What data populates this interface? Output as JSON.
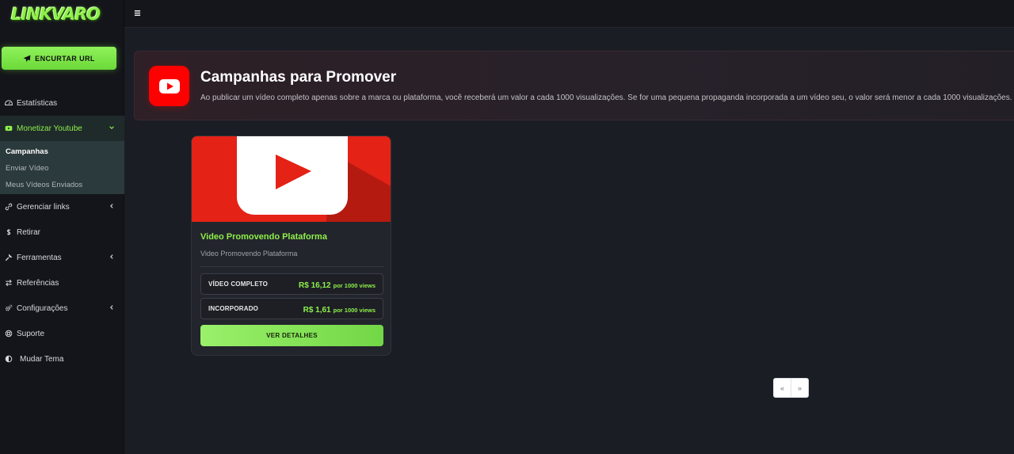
{
  "sidebar": {
    "logo_text": "LINKVARO",
    "shorten_button": "ENCURTAR URL",
    "items": [
      {
        "label": "Estatísticas",
        "icon": "dashboard-icon"
      },
      {
        "label": "Monetizar Youtube",
        "icon": "youtube-icon"
      },
      {
        "label": "Gerenciar links",
        "icon": "link-icon"
      },
      {
        "label": "Retirar",
        "icon": "dollar-icon"
      },
      {
        "label": "Ferramentas",
        "icon": "wrench-icon"
      },
      {
        "label": "Referências",
        "icon": "exchange-icon"
      },
      {
        "label": "Configurações",
        "icon": "cogs-icon"
      },
      {
        "label": "Suporte",
        "icon": "lifebuoy-icon"
      },
      {
        "label": "Mudar Tema",
        "icon": "contrast-icon"
      }
    ],
    "submenu": [
      {
        "label": "Campanhas"
      },
      {
        "label": "Enviar Vídeo"
      },
      {
        "label": "Meus Vídeos Enviados"
      }
    ]
  },
  "banner": {
    "title": "Campanhas para Promover",
    "description": "Ao publicar um vídeo completo apenas sobre a marca ou plataforma, você receberá um valor a cada 1000 visualizações. Se for uma pequena propaganda incorporada a um vídeo seu, o valor será menor a cada 1000 visualizações."
  },
  "card": {
    "title": "Video Promovendo Plataforma",
    "subtitle": "Video Promovendo Plataforma",
    "prices": [
      {
        "label": "VÍDEO COMPLETO",
        "value": "R$ 16,12",
        "unit": "por 1000 views"
      },
      {
        "label": "INCORPORADO",
        "value": "R$ 1,61",
        "unit": "por 1000 views"
      }
    ],
    "details_button": "VER DETALHES"
  },
  "pagination": {
    "prev": "«",
    "next": "»"
  },
  "colors": {
    "accent_green": "#8ef04a",
    "youtube_red": "#ff0000",
    "background": "#1b1d24",
    "sidebar_bg": "#14151a"
  }
}
